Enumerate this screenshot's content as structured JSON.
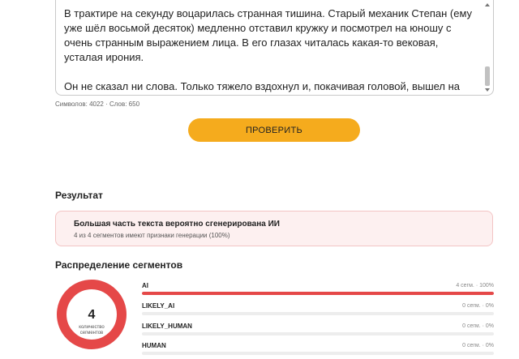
{
  "editor": {
    "text": "В трактире на секунду воцарилась странная тишина. Старый механик Степан (ему уже шёл восьмой десяток) медленно отставил кружку и посмотрел на юношу с очень странным выражением лица. В его глазах читалась какая-то вековая, усталая ирония.\n\nОн не сказал ни слова. Только тяжело вздохнул и, покачивая головой, вышел на улицу, где ровно и бесшумно проехал первый в городе электрический омнибус. Тот самый, для которого ещё не построили ни одной зарядной станции в радиусе пятидесяти вёрст.",
    "counter": "Символов: 4022 · Слов: 650"
  },
  "check_button_label": "ПРОВЕРИТЬ",
  "result": {
    "title": "Результат",
    "main": "Большая часть текста вероятно сгенерирована ИИ",
    "sub": "4 из 4 сегментов имеют признаки генерации (100%)"
  },
  "distribution": {
    "title": "Распределение сегментов",
    "count": "4",
    "count_caption_line1": "количество",
    "count_caption_line2": "сегментов",
    "segments": [
      {
        "label": "AI",
        "value": "4 сегм. · 100%",
        "fraction": 1.0
      },
      {
        "label": "LIKELY_AI",
        "value": "0 сегм. · 0%",
        "fraction": 0
      },
      {
        "label": "LIKELY_HUMAN",
        "value": "0 сегм. · 0%",
        "fraction": 0
      },
      {
        "label": "HUMAN",
        "value": "0 сегм. · 0%",
        "fraction": 0
      }
    ]
  },
  "colors": {
    "accent_button": "#f5ab1d",
    "ai_red": "#e54848",
    "result_bg": "#fdf0f0"
  }
}
